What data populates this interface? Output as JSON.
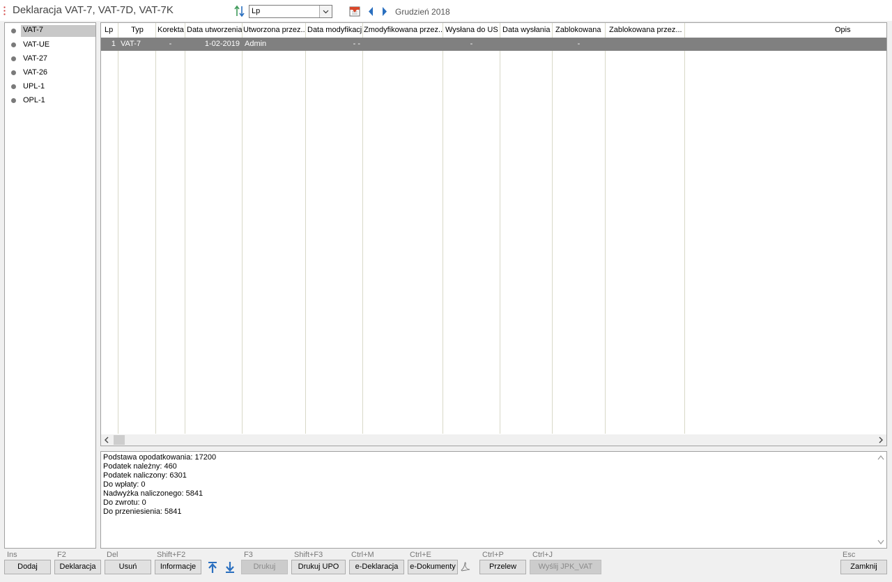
{
  "window": {
    "title": "Deklaracja VAT-7, VAT-7D, VAT-7K"
  },
  "toolbar": {
    "sort_value": "Lp",
    "period_label": "Grudzień 2018"
  },
  "sidebar": {
    "items": [
      {
        "label": "VAT-7",
        "selected": true
      },
      {
        "label": "VAT-UE"
      },
      {
        "label": "VAT-27"
      },
      {
        "label": "VAT-26"
      },
      {
        "label": "UPL-1"
      },
      {
        "label": "OPL-1"
      }
    ]
  },
  "grid": {
    "columns": [
      "Lp",
      "Typ",
      "Korekta",
      "Data utworzenia",
      "Utworzona przez...",
      "Data modyfikacji",
      "Zmodyfikowana przez...",
      "Wysłana do US",
      "Data wysłania",
      "Zablokowana",
      "Zablokowana przez...",
      "Opis"
    ],
    "rows": [
      [
        "1",
        "VAT-7",
        "-",
        "1-02-2019",
        "Admin",
        "- -",
        "",
        "-",
        "",
        "-",
        "",
        ""
      ]
    ]
  },
  "summary": {
    "lines": [
      "Podstawa opodatkowania: 17200",
      "Podatek należny: 460",
      "Podatek naliczony: 6301",
      "Do wpłaty: 0",
      "Nadwyżka naliczonego: 5841",
      "Do zwrotu: 0",
      "Do przeniesienia: 5841"
    ]
  },
  "footer": {
    "shortcuts": {
      "dodaj": "Ins",
      "deklaracja": "F2",
      "usun": "Del",
      "informacje": "Shift+F2",
      "drukuj": "F3",
      "drukuj_upo": "Shift+F3",
      "e_deklaracja": "Ctrl+M",
      "e_dokumenty": "Ctrl+E",
      "przelew": "Ctrl+P",
      "wyslij": "Ctrl+J",
      "zamknij": "Esc"
    },
    "buttons": {
      "dodaj": "Dodaj",
      "deklaracja": "Deklaracja",
      "usun": "Usuń",
      "informacje": "Informacje",
      "drukuj": "Drukuj",
      "drukuj_upo": "Drukuj UPO",
      "e_deklaracja": "e-Deklaracja",
      "e_dokumenty": "e-Dokumenty",
      "przelew": "Przelew",
      "wyslij": "Wyślij JPK_VAT",
      "zamknij": "Zamknij"
    }
  },
  "colors": {
    "selection": "#808080",
    "accent_blue": "#2a6fbf",
    "accent_green": "#3f9a5a"
  }
}
